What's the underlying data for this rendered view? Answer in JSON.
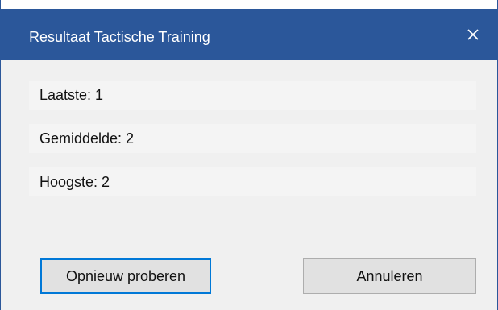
{
  "window": {
    "title": "Resultaat Tactische Training",
    "close_icon": "close-icon",
    "titlebar_color": "#2b579a"
  },
  "stats": {
    "last": "Laatste: 1",
    "average": "Gemiddelde: 2",
    "highest": "Hoogste: 2"
  },
  "buttons": {
    "retry_label": "Opnieuw proberen",
    "cancel_label": "Annuleren"
  }
}
